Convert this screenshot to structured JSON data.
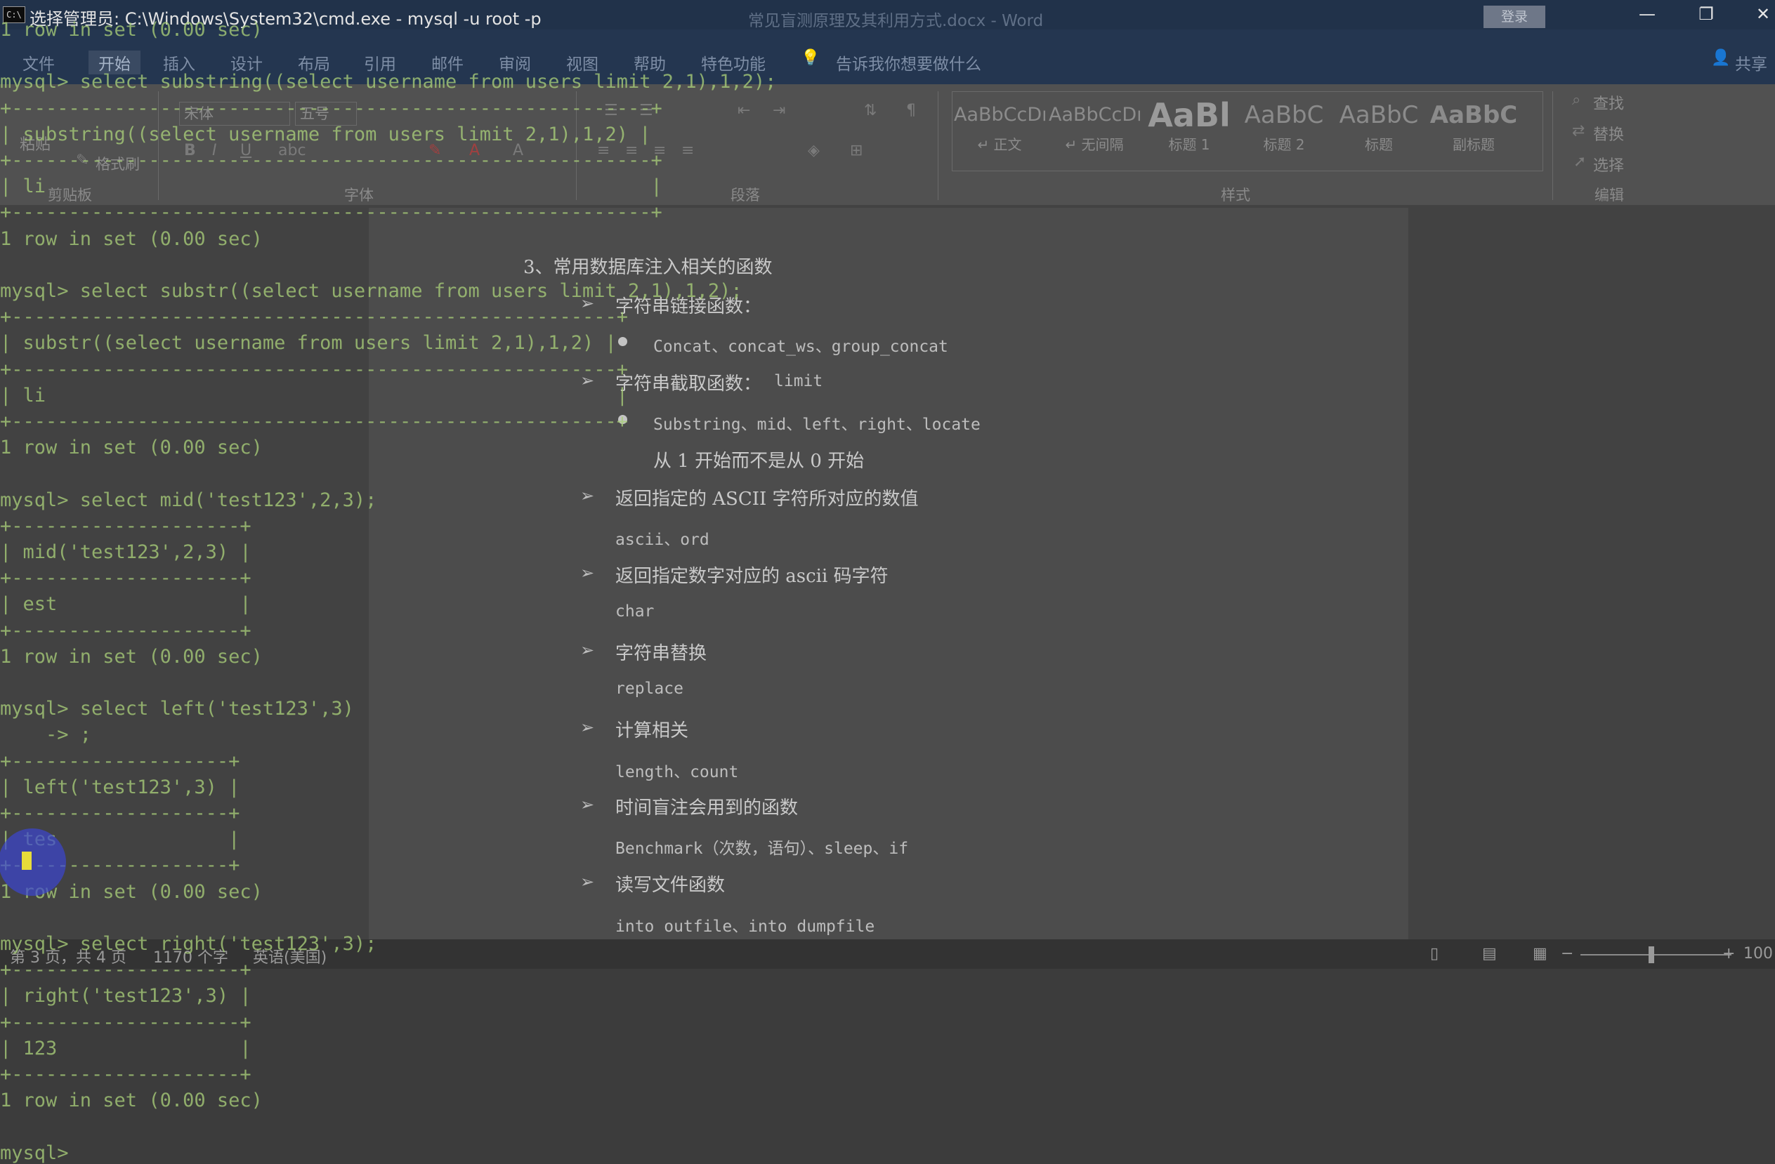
{
  "word": {
    "title": "常见盲测原理及其利用方式.docx  -  Word",
    "login_label": "登录",
    "window_controls": {
      "minimize": "—",
      "restore": "❐",
      "close": "✕"
    },
    "tabs": [
      "文件",
      "开始",
      "插入",
      "设计",
      "布局",
      "引用",
      "邮件",
      "审阅",
      "视图",
      "帮助",
      "特色功能"
    ],
    "tell_me": "告诉我你想要做什么",
    "share": "共享",
    "ribbon": {
      "paste": "粘贴",
      "format_painter": "格式刷",
      "font_name": "宋体",
      "font_size": "五号",
      "groups": [
        "剪贴板",
        "字体",
        "段落",
        "样式",
        "编辑"
      ],
      "styles": [
        {
          "sample": "AaBbCcDı",
          "name": "↵ 正文"
        },
        {
          "sample": "AaBbCcDı",
          "name": "↵ 无间隔"
        },
        {
          "sample": "AaBl",
          "name": "标题 1"
        },
        {
          "sample": "AaBbC",
          "name": "标题 2"
        },
        {
          "sample": "AaBbC",
          "name": "标题"
        },
        {
          "sample": "AaBbC",
          "name": "副标题"
        }
      ],
      "editing": [
        "查找",
        "替换",
        "选择"
      ]
    },
    "document": {
      "heading": "3、常用数据库注入相关的函数",
      "sections": [
        {
          "title": "字符串链接函数：",
          "detail": "Concat、concat_ws、group_concat",
          "bullet": true
        },
        {
          "title": "字符串截取函数：",
          "title_note": "limit",
          "detail": "Substring、mid、left、right、locate",
          "bullet": true,
          "note": "从 1 开始而不是从 0 开始"
        },
        {
          "title": "返回指定的 ASCII 字符所对应的数值",
          "detail": "ascii、ord"
        },
        {
          "title": "返回指定数字对应的 ascii 码字符",
          "detail": "char"
        },
        {
          "title": "字符串替换",
          "detail": "replace"
        },
        {
          "title": "计算相关",
          "detail": "length、count"
        },
        {
          "title": "时间盲注会用到的函数",
          "detail": "Benchmark（次数，语句）、sleep、if"
        },
        {
          "title": "读写文件函数",
          "detail": "into outfile、into dumpfile"
        }
      ]
    },
    "status": {
      "page": "第 3 页，共 4 页",
      "words": "1170 个字",
      "language": "英语(美国)",
      "zoom": "100"
    }
  },
  "cmd": {
    "title": "选择管理员: C:\\Windows\\System32\\cmd.exe - mysql  -u root -p",
    "icon_text": "C:\\",
    "lines": [
      "1 row in set (0.00 sec)",
      "",
      "mysql> select substring((select username from users limit 2,1),1,2);",
      "+--------------------------------------------------------+",
      "| substring((select username from users limit 2,1),1,2) |",
      "+--------------------------------------------------------+",
      "| li                                                     |",
      "+--------------------------------------------------------+",
      "1 row in set (0.00 sec)",
      "",
      "mysql> select substr((select username from users limit 2,1),1,2);",
      "+-----------------------------------------------------+",
      "| substr((select username from users limit 2,1),1,2) |",
      "+-----------------------------------------------------+",
      "| li                                                  |",
      "+-----------------------------------------------------+",
      "1 row in set (0.00 sec)",
      "",
      "mysql> select mid('test123',2,3);",
      "+--------------------+",
      "| mid('test123',2,3) |",
      "+--------------------+",
      "| est                |",
      "+--------------------+",
      "1 row in set (0.00 sec)",
      "",
      "mysql> select left('test123',3)",
      "    -> ;",
      "+-------------------+",
      "| left('test123',3) |",
      "+-------------------+",
      "| tes               |",
      "+-------------------+",
      "1 row in set (0.00 sec)",
      "",
      "mysql> select right('test123',3);",
      "+--------------------+",
      "| right('test123',3) |",
      "+--------------------+",
      "| 123                |",
      "+--------------------+",
      "1 row in set (0.00 sec)",
      "",
      "mysql>"
    ]
  }
}
